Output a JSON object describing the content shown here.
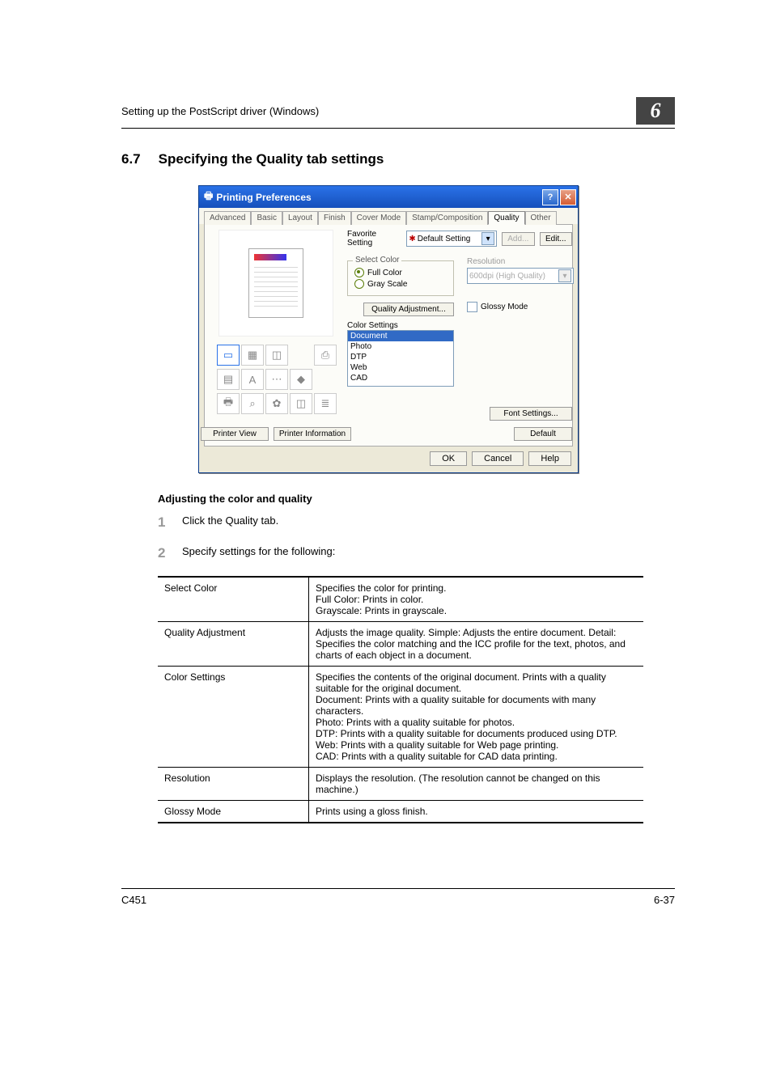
{
  "header": {
    "breadcrumb": "Setting up the PostScript driver (Windows)",
    "chapter": "6"
  },
  "section": {
    "num": "6.7",
    "title": "Specifying the Quality tab settings"
  },
  "dialog": {
    "title": "Printing Preferences",
    "tabs": [
      "Advanced",
      "Basic",
      "Layout",
      "Finish",
      "Cover Mode",
      "Stamp/Composition",
      "Quality",
      "Other"
    ],
    "favorite": {
      "label": "Favorite Setting",
      "value": "Default Setting",
      "add": "Add...",
      "edit": "Edit..."
    },
    "selectColor": {
      "label": "Select Color",
      "full": "Full Color",
      "gray": "Gray Scale"
    },
    "qualityAdjustBtn": "Quality Adjustment...",
    "colorSettings": {
      "label": "Color Settings",
      "items": [
        "Document",
        "Photo",
        "DTP",
        "Web",
        "CAD"
      ]
    },
    "resolution": {
      "label": "Resolution",
      "value": "600dpi (High Quality)"
    },
    "glossy": "Glossy Mode",
    "fontSettingsBtn": "Font Settings...",
    "printerViewBtn": "Printer View",
    "printerInfoBtn": "Printer Information",
    "defaultBtn": "Default",
    "ok": "OK",
    "cancel": "Cancel",
    "help": "Help"
  },
  "subhead": "Adjusting the color and quality",
  "steps": [
    "Click the Quality tab.",
    "Specify settings for the following:"
  ],
  "table": [
    {
      "name": "Select Color",
      "desc": "Specifies the color for printing.\nFull Color: Prints in color.\nGrayscale: Prints in grayscale."
    },
    {
      "name": "Quality Adjustment",
      "desc": "Adjusts the image quality. Simple: Adjusts the entire document. Detail: Specifies the color matching and the ICC profile for the text, photos, and charts of each object in a document."
    },
    {
      "name": "Color Settings",
      "desc": "Specifies the contents of the original document. Prints with a quality suitable for the original document.\nDocument: Prints with a quality suitable for documents with many characters.\nPhoto: Prints with a quality suitable for photos.\nDTP: Prints with a quality suitable for documents produced using DTP.\nWeb: Prints with a quality suitable for Web page printing.\nCAD: Prints with a quality suitable for CAD data printing."
    },
    {
      "name": "Resolution",
      "desc": "Displays the resolution. (The resolution cannot be changed on this machine.)"
    },
    {
      "name": "Glossy Mode",
      "desc": "Prints using a gloss finish."
    }
  ],
  "footer": {
    "left": "C451",
    "right": "6-37"
  }
}
